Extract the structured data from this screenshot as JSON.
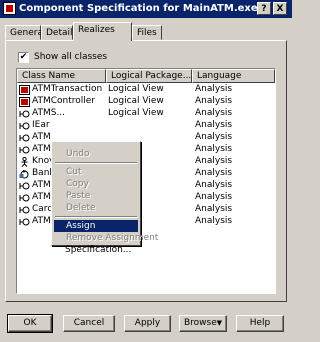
{
  "window": {
    "title": "Component Specification for MainATM.exe",
    "help_label": "?",
    "close_label": "X"
  },
  "tabs": [
    {
      "label": "General",
      "active": false
    },
    {
      "label": "Detail",
      "active": false
    },
    {
      "label": "Realizes",
      "active": true
    },
    {
      "label": "Files",
      "active": false
    }
  ],
  "show_all": {
    "label": "Show all classes",
    "checked": true,
    "mark": "✔"
  },
  "list": {
    "columns": [
      "Class Name",
      "Logical Package...",
      "Language"
    ],
    "rows": [
      {
        "icon": "class-icon",
        "name": "ATMTransaction",
        "package": "Logical View",
        "language": "Analysis"
      },
      {
        "icon": "class-icon",
        "name": "ATMController",
        "package": "Logical View",
        "language": "Analysis"
      },
      {
        "icon": "boundary-icon",
        "name": "ATMS...",
        "package": "Logical View",
        "language": "Analysis"
      },
      {
        "icon": "boundary-icon",
        "name": "IEar",
        "package": "",
        "language": "Analysis"
      },
      {
        "icon": "boundary-icon",
        "name": "ATM",
        "package": "",
        "language": "Analysis"
      },
      {
        "icon": "boundary-icon",
        "name": "ATM",
        "package": "",
        "language": "Analysis"
      },
      {
        "icon": "actor-icon",
        "name": "Knov",
        "package": "",
        "language": "Analysis"
      },
      {
        "icon": "control-icon",
        "name": "Bank",
        "package": "",
        "language": "Analysis"
      },
      {
        "icon": "boundary-icon",
        "name": "ATM",
        "package": "",
        "language": "Analysis"
      },
      {
        "icon": "boundary-icon",
        "name": "ATM",
        "package": "",
        "language": "Analysis"
      },
      {
        "icon": "boundary-icon",
        "name": "Card",
        "package": "",
        "language": "Analysis"
      },
      {
        "icon": "boundary-icon",
        "name": "ATM",
        "package": "",
        "language": "Analysis"
      }
    ]
  },
  "context_menu": {
    "items": [
      {
        "label": "Undo",
        "enabled": false
      },
      {
        "label": "Cut",
        "enabled": false
      },
      {
        "label": "Copy",
        "enabled": false
      },
      {
        "label": "Paste",
        "enabled": false
      },
      {
        "label": "Delete",
        "enabled": false
      },
      {
        "label": "Assign",
        "enabled": true,
        "selected": true
      },
      {
        "label": "Remove Assignment",
        "enabled": false
      },
      {
        "label": "Specification...",
        "enabled": true
      }
    ]
  },
  "buttons": {
    "ok": "OK",
    "cancel": "Cancel",
    "apply": "Apply",
    "browse": "Browse",
    "browse_arrow": "▼",
    "help": "Help"
  },
  "colors": {
    "titlebar": "#0a246a",
    "face": "#d4d0c8",
    "class_icon": "#c00000"
  }
}
